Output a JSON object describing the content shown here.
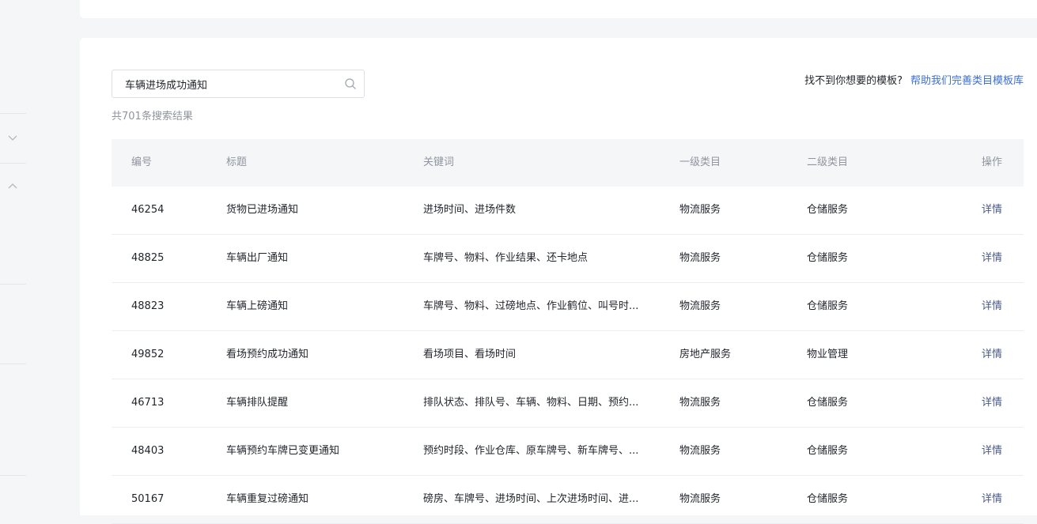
{
  "search": {
    "value": "车辆进场成功通知"
  },
  "result_count": "共701条搜索结果",
  "help": {
    "question": "找不到你想要的模板?",
    "link": "帮助我们完善类目模板库"
  },
  "table": {
    "headers": {
      "id": "编号",
      "title": "标题",
      "keywords": "关键词",
      "category1": "一级类目",
      "category2": "二级类目",
      "action": "操作"
    },
    "rows": [
      {
        "id": "46254",
        "title": "货物已进场通知",
        "keywords": "进场时间、进场件数",
        "category1": "物流服务",
        "category2": "仓储服务",
        "action": "详情"
      },
      {
        "id": "48825",
        "title": "车辆出厂通知",
        "keywords": "车牌号、物料、作业结果、还卡地点",
        "category1": "物流服务",
        "category2": "仓储服务",
        "action": "详情"
      },
      {
        "id": "48823",
        "title": "车辆上磅通知",
        "keywords": "车牌号、物料、过磅地点、作业鹤位、叫号时...",
        "category1": "物流服务",
        "category2": "仓储服务",
        "action": "详情"
      },
      {
        "id": "49852",
        "title": "看场预约成功通知",
        "keywords": "看场项目、看场时间",
        "category1": "房地产服务",
        "category2": "物业管理",
        "action": "详情"
      },
      {
        "id": "46713",
        "title": "车辆排队提醒",
        "keywords": "排队状态、排队号、车辆、物料、日期、预约...",
        "category1": "物流服务",
        "category2": "仓储服务",
        "action": "详情"
      },
      {
        "id": "48403",
        "title": "车辆预约车牌已变更通知",
        "keywords": "预约时段、作业仓库、原车牌号、新车牌号、...",
        "category1": "物流服务",
        "category2": "仓储服务",
        "action": "详情"
      },
      {
        "id": "50167",
        "title": "车辆重复过磅通知",
        "keywords": "磅房、车牌号、进场时间、上次进场时间、进...",
        "category1": "物流服务",
        "category2": "仓储服务",
        "action": "详情"
      }
    ]
  }
}
